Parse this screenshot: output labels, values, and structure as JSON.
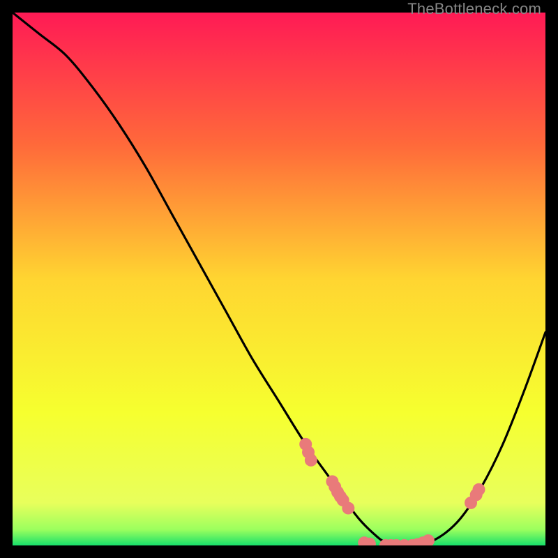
{
  "watermark": "TheBottleneck.com",
  "chart_data": {
    "type": "line",
    "title": "",
    "xlabel": "",
    "ylabel": "",
    "xlim": [
      0,
      100
    ],
    "ylim": [
      0,
      100
    ],
    "grid": false,
    "legend": false,
    "background_gradient": {
      "type": "vertical",
      "stops": [
        {
          "offset": 0.0,
          "color": "#ff1a55"
        },
        {
          "offset": 0.25,
          "color": "#ff6a3a"
        },
        {
          "offset": 0.5,
          "color": "#ffd531"
        },
        {
          "offset": 0.75,
          "color": "#f6ff2f"
        },
        {
          "offset": 0.92,
          "color": "#e8ff5c"
        },
        {
          "offset": 0.97,
          "color": "#9cff5e"
        },
        {
          "offset": 1.0,
          "color": "#18e06a"
        }
      ]
    },
    "series": [
      {
        "name": "bottleneck-curve",
        "color": "#000000",
        "x": [
          0,
          5,
          10,
          15,
          20,
          25,
          30,
          35,
          40,
          45,
          50,
          55,
          60,
          62,
          65,
          68,
          70,
          73,
          76,
          80,
          84,
          88,
          92,
          96,
          100
        ],
        "y": [
          100,
          96,
          92,
          86,
          79,
          71,
          62,
          53,
          44,
          35,
          27,
          19,
          12,
          9,
          5,
          2,
          0.6,
          0,
          0,
          1.5,
          5,
          11,
          19,
          29,
          40
        ]
      }
    ],
    "markers": {
      "name": "data-points",
      "color": "#e97a7a",
      "radius": 9,
      "points": [
        {
          "x": 55,
          "y": 19
        },
        {
          "x": 55.5,
          "y": 17.5
        },
        {
          "x": 56,
          "y": 16
        },
        {
          "x": 60,
          "y": 12
        },
        {
          "x": 60.5,
          "y": 11
        },
        {
          "x": 61,
          "y": 10
        },
        {
          "x": 61.5,
          "y": 9.2
        },
        {
          "x": 62,
          "y": 8.5
        },
        {
          "x": 63,
          "y": 7
        },
        {
          "x": 66,
          "y": 0.5
        },
        {
          "x": 67,
          "y": 0.3
        },
        {
          "x": 70,
          "y": 0
        },
        {
          "x": 71,
          "y": 0
        },
        {
          "x": 72,
          "y": 0
        },
        {
          "x": 73.5,
          "y": 0
        },
        {
          "x": 75,
          "y": 0
        },
        {
          "x": 76,
          "y": 0.2
        },
        {
          "x": 77,
          "y": 0.5
        },
        {
          "x": 78,
          "y": 0.9
        },
        {
          "x": 86,
          "y": 8
        },
        {
          "x": 87,
          "y": 9.5
        },
        {
          "x": 87.5,
          "y": 10.5
        }
      ]
    }
  }
}
